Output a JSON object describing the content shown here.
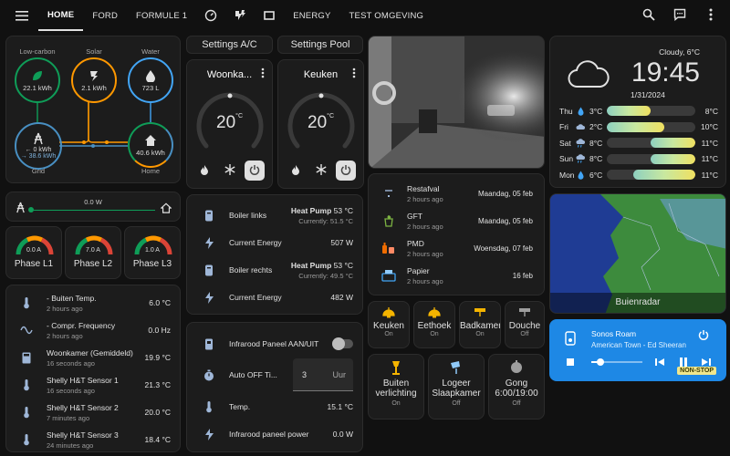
{
  "nav": {
    "tabs": [
      {
        "label": "HOME",
        "active": true
      },
      {
        "label": "FORD"
      },
      {
        "label": "FORMULE 1"
      },
      {
        "icon": "speedometer-icon"
      },
      {
        "icon": "power-plug-lightning-icon"
      },
      {
        "icon": "rectangle-outline-icon"
      },
      {
        "label": "ENERGY"
      },
      {
        "label": "TEST OMGEVING"
      }
    ],
    "right_icons": [
      "search-icon",
      "chat-icon",
      "more-vertical-icon"
    ]
  },
  "energy": {
    "low_carbon": {
      "label": "Low-carbon",
      "value": "22.1 kWh"
    },
    "solar": {
      "label": "Solar",
      "value": "2.1 kWh"
    },
    "water": {
      "label": "Water",
      "value": "723 L"
    },
    "grid": {
      "label": "Grid",
      "in": "← 0 kWh",
      "out": "→ 38.6 kWh"
    },
    "home": {
      "label": "Home",
      "value": "40.6 kWh"
    },
    "colors": {
      "low_carbon": "#0f9d58",
      "solar": "#ff9800",
      "water": "#42a5f5",
      "grid": "#488fc2",
      "home": "#0f9d58"
    }
  },
  "power_bar": {
    "value": "0.0 W"
  },
  "phases": [
    {
      "label": "Phase L1",
      "value": "0.0 A"
    },
    {
      "label": "Phase L2",
      "value": "7.0 A"
    },
    {
      "label": "Phase L3",
      "value": "1.0 A"
    }
  ],
  "sensors": [
    {
      "title": "- Buiten Temp.",
      "sub": "2 hours ago",
      "value": "6.0 °C",
      "icon": "thermometer-icon"
    },
    {
      "title": "- Compr. Frequency",
      "sub": "2 hours ago",
      "value": "0.0 Hz",
      "icon": "sine-wave-icon"
    },
    {
      "title": "Woonkamer (Gemiddeld)",
      "sub": "16 seconds ago",
      "value": "19.9 °C",
      "icon": "calculator-icon"
    },
    {
      "title": "Shelly H&T Sensor 1",
      "sub": "16 seconds ago",
      "value": "21.3 °C",
      "icon": "thermometer-icon"
    },
    {
      "title": "Shelly H&T Sensor 2",
      "sub": "7 minutes ago",
      "value": "20.0 °C",
      "icon": "thermometer-icon"
    },
    {
      "title": "Shelly H&T Sensor 3",
      "sub": "24 minutes ago",
      "value": "18.4 °C",
      "icon": "thermometer-icon"
    }
  ],
  "settings_buttons": {
    "ac": "Settings A/C",
    "pool": "Settings Pool"
  },
  "thermostats": [
    {
      "name": "Woonka...",
      "temp": "20",
      "unit": "°C"
    },
    {
      "name": "Keuken",
      "temp": "20",
      "unit": "°C"
    }
  ],
  "boilers": [
    {
      "title": "Boiler links",
      "mode": "Heat Pump",
      "temp": "53 °C",
      "current": "Currently: 51.5 °C"
    },
    {
      "title": "Current Energy",
      "value": "507 W"
    },
    {
      "title": "Boiler rechts",
      "mode": "Heat Pump",
      "temp": "53 °C",
      "current": "Currently: 49.5 °C"
    },
    {
      "title": "Current Energy",
      "value": "482 W"
    }
  ],
  "infrared": {
    "toggle_label": "Infrarood Paneel AAN/UIT",
    "timer_label": "Auto OFF Ti...",
    "timer_value": "3",
    "timer_unit": "Uur",
    "temp_label": "Temp.",
    "temp_value": "15.1 °C",
    "power_label": "Infrarood paneel power",
    "power_value": "0.0 W"
  },
  "waste": [
    {
      "title": "Restafval",
      "sub": "2 hours ago",
      "date": "Maandag, 05 feb",
      "icon": "bin-icon"
    },
    {
      "title": "GFT",
      "sub": "2 hours ago",
      "date": "Maandag, 05 feb",
      "icon": "leaf-bin-icon"
    },
    {
      "title": "PMD",
      "sub": "2 hours ago",
      "date": "Woensdag, 07 feb",
      "icon": "bottles-icon"
    },
    {
      "title": "Papier",
      "sub": "2 hours ago",
      "date": "16 feb",
      "icon": "paper-bin-icon"
    }
  ],
  "light_tiles": [
    {
      "name": "Keuken",
      "state": "On"
    },
    {
      "name": "Eethoek",
      "state": "On"
    },
    {
      "name": "Badkamer",
      "state": "On"
    },
    {
      "name": "Douche",
      "state": "Off"
    }
  ],
  "big_tiles": [
    {
      "name": "Buiten",
      "name2": "verlichting",
      "state": "On"
    },
    {
      "name": "Logeer",
      "name2": "Slaapkamer",
      "state": "Off"
    },
    {
      "name": "Gong",
      "name2": "6:00/19:00",
      "state": "Off"
    }
  ],
  "weather": {
    "condition": "Cloudy, 6°C",
    "time": "19:45",
    "date": "1/31/2024",
    "days": [
      {
        "day": "Thu",
        "low": "3°C",
        "high": "8°C",
        "icon": "rain-drop-icon",
        "fill": [
          0.0,
          0.5
        ]
      },
      {
        "day": "Fri",
        "low": "2°C",
        "high": "10°C",
        "icon": "cloud-icon",
        "fill": [
          0.0,
          0.65
        ]
      },
      {
        "day": "Sat",
        "low": "8°C",
        "high": "11°C",
        "icon": "rain-cloud-icon",
        "fill": [
          0.5,
          1.0
        ]
      },
      {
        "day": "Sun",
        "low": "8°C",
        "high": "11°C",
        "icon": "rain-cloud-icon",
        "fill": [
          0.5,
          1.0
        ]
      },
      {
        "day": "Mon",
        "low": "6°C",
        "high": "11°C",
        "icon": "rain-drop-icon",
        "fill": [
          0.3,
          1.0
        ]
      }
    ]
  },
  "radar": {
    "label": "Buienradar"
  },
  "media": {
    "source": "Sonos Roam",
    "track": "American Town - Ed Sheeran",
    "progress": 0.18,
    "badge": "NON-STOP",
    "accent": "#1e88e5"
  }
}
